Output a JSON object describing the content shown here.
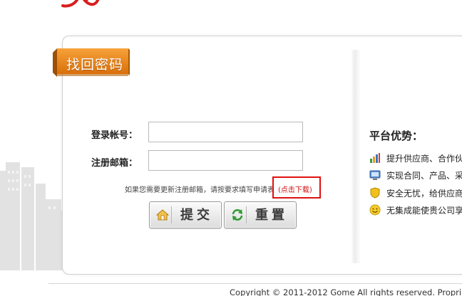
{
  "title_tab": {
    "label": "找回密码"
  },
  "form": {
    "account_label": "登录帐号：",
    "account_value": "",
    "email_label": "注册邮箱：",
    "email_value": "",
    "hint_text": "如果您需要更新注册邮箱，请按要求填写申请表",
    "download_link": "(点击下载)",
    "submit_label": "提交",
    "reset_label": "重置"
  },
  "advantages": {
    "title": "平台优势：",
    "items": [
      {
        "icon": "bar-chart-icon",
        "text": "提升供应商、合作伙"
      },
      {
        "icon": "monitor-icon",
        "text": "实现合同、产品、采"
      },
      {
        "icon": "shield-icon",
        "text": "安全无忧，给供应商"
      },
      {
        "icon": "smiley-icon",
        "text": "无集成能使贵公司享"
      }
    ]
  },
  "footer": {
    "copyright": "Copyright © 2011-2012 Gome All rights reserved. Propri"
  },
  "colors": {
    "tab_orange": "#e8840c",
    "link_red": "#d01010",
    "box_red": "#e01010"
  }
}
